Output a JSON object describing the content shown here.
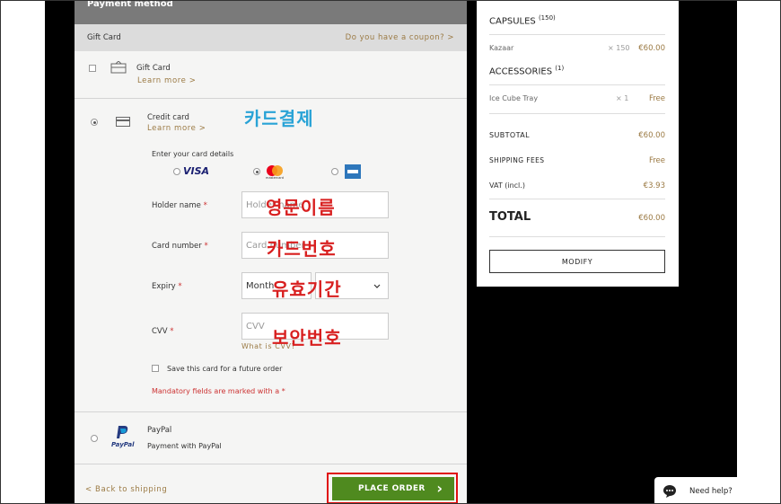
{
  "payment": {
    "title": "Payment method",
    "gift_card_header": "Gift Card",
    "coupon_link": "Do you have a coupon? >",
    "gift_card": {
      "label": "Gift Card",
      "learn_more": "Learn more >"
    },
    "credit_card": {
      "label": "Credit card",
      "learn_more": "Learn more >"
    },
    "enter_details": "Enter your card details",
    "card_brands": [
      "VISA",
      "mastercard",
      "amex"
    ],
    "fields": {
      "holder_label": "Holder name",
      "holder_placeholder": "Holder name",
      "number_label": "Card number",
      "number_placeholder": "Card number",
      "expiry_label": "Expiry",
      "expiry_month": "Month",
      "cvv_label": "CVV",
      "cvv_placeholder": "CVV",
      "cvv_help": "What is CVV?",
      "required_mark": "*"
    },
    "save_card": "Save this card for a future order",
    "mandatory_note": "Mandatory fields are marked with a *",
    "paypal": {
      "label": "PayPal",
      "sublabel": "Payment with PayPal",
      "logo_text": "PayPal"
    },
    "back_link": "< Back to shipping",
    "place_order": "PLACE ORDER",
    "place_order_arrow": "›"
  },
  "annotations": {
    "card_payment": "카드결제",
    "english_name": "영문이름",
    "card_number": "카드번호",
    "expiry": "유효기간",
    "security_code": "보안번호"
  },
  "summary": {
    "capsules_title": "CAPSULES",
    "capsules_count": "(150)",
    "capsule_item": {
      "name": "Kazaar",
      "qty": "× 150",
      "price": "€60.00"
    },
    "accessories_title": "ACCESSORIES",
    "accessories_count": "(1)",
    "accessory_item": {
      "name": "Ice Cube Tray",
      "qty": "× 1",
      "price": "Free"
    },
    "subtotal_label": "SUBTOTAL",
    "subtotal_value": "€60.00",
    "shipping_label": "SHIPPING FEES",
    "shipping_value": "Free",
    "vat_label": "VAT (incl.)",
    "vat_value": "€3.93",
    "total_label": "TOTAL",
    "total_value": "€60.00",
    "modify": "MODIFY"
  },
  "help": {
    "label": "Need help?"
  },
  "colors": {
    "accent_gold": "#9b7a44",
    "order_green": "#4f8a1f",
    "highlight_red": "#e01010",
    "annotation_blue": "#29a3d6",
    "annotation_red": "#d81f1f"
  }
}
